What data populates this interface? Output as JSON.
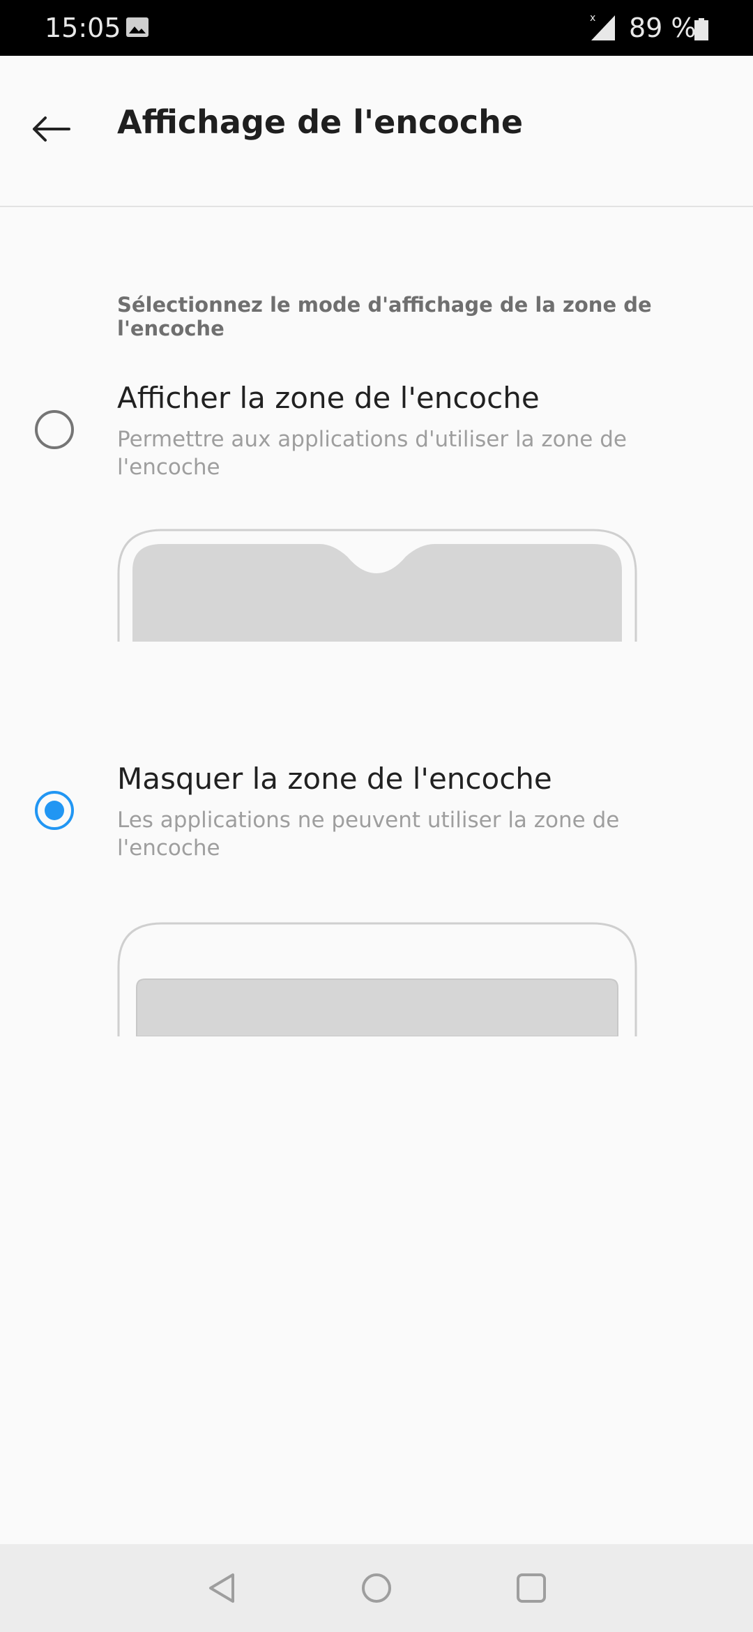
{
  "status_bar": {
    "time": "15:05",
    "battery": "89 %",
    "icons": [
      "image-icon",
      "signal-icon",
      "battery-icon"
    ]
  },
  "toolbar": {
    "title": "Affichage de l'encoche",
    "back_icon": "arrow-left-icon"
  },
  "section": {
    "header": "Sélectionnez le mode d'affichage de la zone de l'encoche"
  },
  "options": [
    {
      "title": "Afficher la zone de l'encoche",
      "summary": "Permettre aux applications d'utiliser la zone de l'encoche",
      "selected": false,
      "illustration": "notch-shown"
    },
    {
      "title": "Masquer la zone de l'encoche",
      "summary": "Les applications ne peuvent utiliser la zone de l'encoche",
      "selected": true,
      "illustration": "notch-hidden"
    }
  ],
  "colors": {
    "accent": "#2196f3",
    "radio_unselected": "#757575",
    "illustration_fill": "#d6d6d6",
    "illustration_stroke": "#cfcfcf"
  },
  "nav_bar": {
    "icons": [
      "back-triangle-icon",
      "home-circle-icon",
      "recents-square-icon"
    ]
  }
}
